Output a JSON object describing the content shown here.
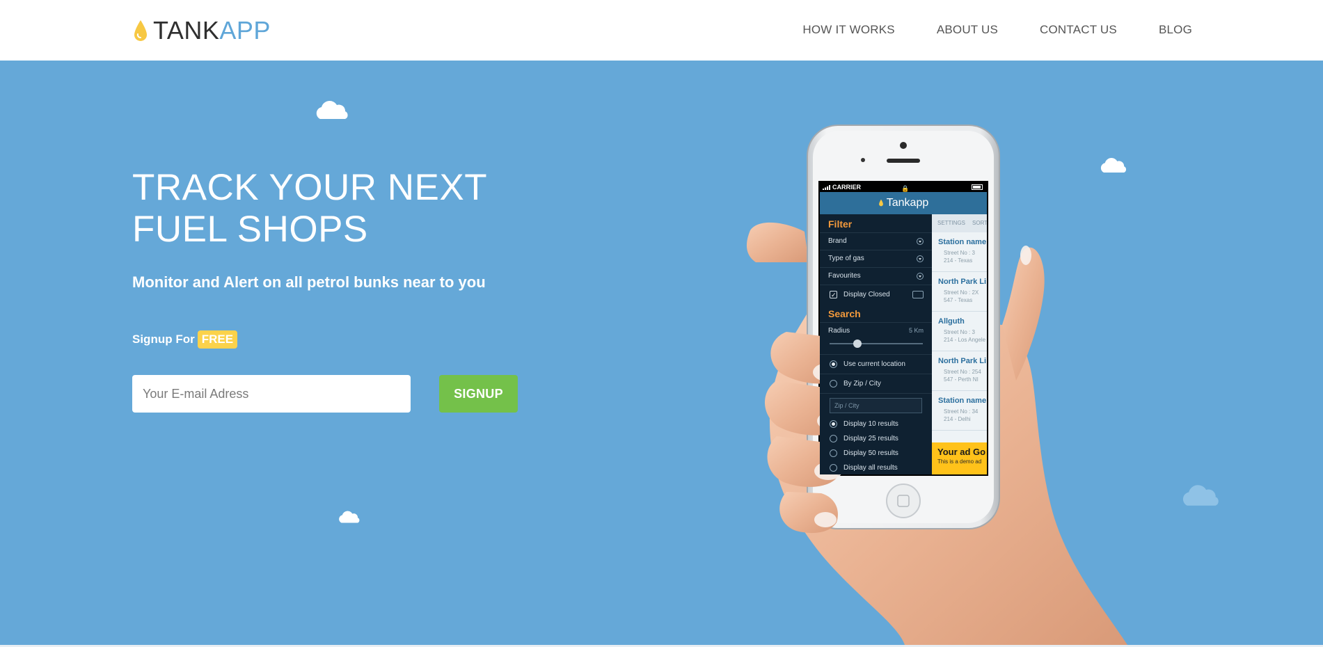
{
  "header": {
    "logo_dark": "TANK",
    "logo_blue": "APP",
    "nav": [
      {
        "label": "HOW IT WORKS"
      },
      {
        "label": "ABOUT US"
      },
      {
        "label": "CONTACT US"
      },
      {
        "label": "BLOG"
      }
    ]
  },
  "hero": {
    "headline_line1": "TRACK YOUR NEXT",
    "headline_line2": "FUEL SHOPS",
    "subhead": "Monitor and Alert on all petrol bunks near to you",
    "signup_prefix": "Signup For",
    "free_badge": "FREE",
    "email_placeholder": "Your E-mail Adress",
    "signup_button": "SIGNUP"
  },
  "colors": {
    "hero_bg": "#65a8d8",
    "signup_green": "#74c14a",
    "free_yellow": "#fbd24b",
    "logo_blue": "#5fa6d8",
    "logo_drop": "#f7c843"
  },
  "phone_screen": {
    "carrier": "CARRIER",
    "app_title": "Tankapp",
    "filter_title": "Filter",
    "filter_items": [
      "Brand",
      "Type of gas",
      "Favourites"
    ],
    "display_closed": "Display Closed",
    "search_title": "Search",
    "radius_label": "Radius",
    "radius_value": "5 Km",
    "location_options": [
      "Use current location",
      "By Zip / City"
    ],
    "zip_placeholder": "Zip / City",
    "result_options": [
      "Display 10 results",
      "Display 25 results",
      "Display 50 results",
      "Display all results"
    ],
    "list_header": [
      "SETTINGS",
      "SORT"
    ],
    "stations": [
      {
        "name": "Station name",
        "line1": "Street No : 3",
        "line2": "214 - Texas"
      },
      {
        "name": "North Park Li",
        "line1": "Street No : 2X",
        "line2": "547 - Texas"
      },
      {
        "name": "Allguth",
        "line1": "Street No : 3",
        "line2": "214 - Los Angele"
      },
      {
        "name": "North Park Li",
        "line1": "Street No : 254",
        "line2": "547 - Perth NI"
      },
      {
        "name": "Station name",
        "line1": "Street No : 34",
        "line2": "214 - Delhi"
      }
    ],
    "ad_title": "Your ad Go",
    "ad_sub": "This is a demo ad"
  }
}
